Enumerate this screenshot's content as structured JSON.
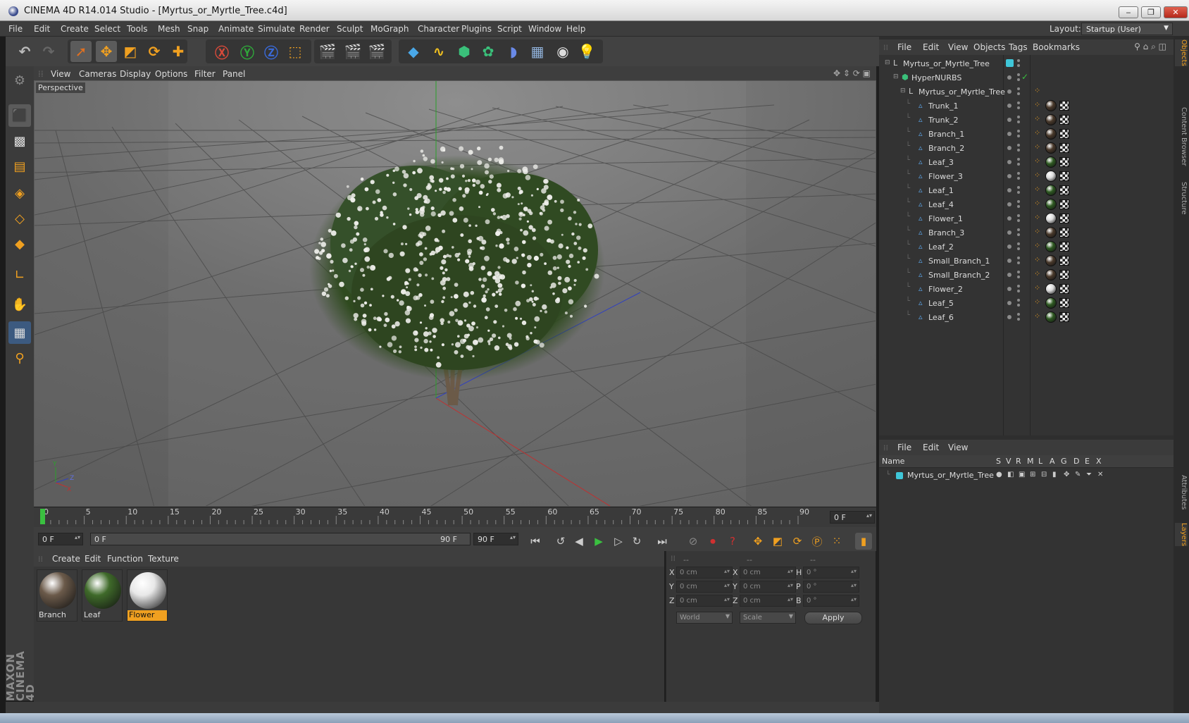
{
  "window": {
    "title": "CINEMA 4D R14.014 Studio - [Myrtus_or_Myrtle_Tree.c4d]",
    "min": "‒",
    "max": "❐",
    "close": "✕"
  },
  "menubar": [
    "File",
    "Edit",
    "Create",
    "Select",
    "Tools",
    "Mesh",
    "Snap",
    "Animate",
    "Simulate",
    "Render",
    "Sculpt",
    "MoGraph",
    "Character",
    "Plugins",
    "Script",
    "Window",
    "Help"
  ],
  "layout": {
    "label": "Layout:",
    "value": "Startup (User)"
  },
  "viewport": {
    "menu": [
      "View",
      "Cameras",
      "Display",
      "Options",
      "Filter",
      "Panel"
    ],
    "label": "Perspective",
    "axis": {
      "x": "X",
      "y": "Y",
      "z": "Z"
    }
  },
  "timeline": {
    "ticks": [
      "0",
      "5",
      "10",
      "15",
      "20",
      "25",
      "30",
      "35",
      "40",
      "45",
      "50",
      "55",
      "60",
      "65",
      "70",
      "75",
      "80",
      "85",
      "90"
    ],
    "current_frame": "0 F",
    "start_field": "0 F",
    "range_start": "0 F",
    "range_end": "90 F",
    "end_field": "90 F"
  },
  "materials": {
    "menu": [
      "Create",
      "Edit",
      "Function",
      "Texture"
    ],
    "items": [
      {
        "name": "Branch",
        "selected": false,
        "color": "#6b5a4a"
      },
      {
        "name": "Leaf",
        "selected": false,
        "color": "#3f6a2a"
      },
      {
        "name": "Flower",
        "selected": true,
        "color": "#e8e8e8"
      }
    ]
  },
  "coordinates": {
    "headers": [
      "--",
      "--",
      "--"
    ],
    "rows": [
      {
        "l1": "X",
        "v1": "0 cm",
        "l2": "X",
        "v2": "0 cm",
        "l3": "H",
        "v3": "0 °"
      },
      {
        "l1": "Y",
        "v1": "0 cm",
        "l2": "Y",
        "v2": "0 cm",
        "l3": "P",
        "v3": "0 °"
      },
      {
        "l1": "Z",
        "v1": "0 cm",
        "l2": "Z",
        "v2": "0 cm",
        "l3": "B",
        "v3": "0 °"
      }
    ],
    "mode1": "World",
    "mode2": "Scale",
    "apply": "Apply"
  },
  "objects_panel": {
    "menu": [
      "File",
      "Edit",
      "View",
      "Objects",
      "Tags",
      "Bookmarks"
    ],
    "tree": [
      {
        "name": "Myrtus_or_Myrtle_Tree",
        "level": 0,
        "type": "null"
      },
      {
        "name": "HyperNURBS",
        "level": 1,
        "type": "nurbs"
      },
      {
        "name": "Myrtus_or_Myrtle_Tree",
        "level": 2,
        "type": "null"
      },
      {
        "name": "Trunk_1",
        "level": 3,
        "type": "poly",
        "mat": "branch"
      },
      {
        "name": "Trunk_2",
        "level": 3,
        "type": "poly",
        "mat": "branch"
      },
      {
        "name": "Branch_1",
        "level": 3,
        "type": "poly",
        "mat": "branch"
      },
      {
        "name": "Branch_2",
        "level": 3,
        "type": "poly",
        "mat": "branch"
      },
      {
        "name": "Leaf_3",
        "level": 3,
        "type": "poly",
        "mat": "leaf"
      },
      {
        "name": "Flower_3",
        "level": 3,
        "type": "poly",
        "mat": "flower"
      },
      {
        "name": "Leaf_1",
        "level": 3,
        "type": "poly",
        "mat": "leaf"
      },
      {
        "name": "Leaf_4",
        "level": 3,
        "type": "poly",
        "mat": "leaf"
      },
      {
        "name": "Flower_1",
        "level": 3,
        "type": "poly",
        "mat": "flower"
      },
      {
        "name": "Branch_3",
        "level": 3,
        "type": "poly",
        "mat": "branch"
      },
      {
        "name": "Leaf_2",
        "level": 3,
        "type": "poly",
        "mat": "leaf"
      },
      {
        "name": "Small_Branch_1",
        "level": 3,
        "type": "poly",
        "mat": "branch"
      },
      {
        "name": "Small_Branch_2",
        "level": 3,
        "type": "poly",
        "mat": "branch"
      },
      {
        "name": "Flower_2",
        "level": 3,
        "type": "poly",
        "mat": "flower"
      },
      {
        "name": "Leaf_5",
        "level": 3,
        "type": "poly",
        "mat": "leaf"
      },
      {
        "name": "Leaf_6",
        "level": 3,
        "type": "poly",
        "mat": "leaf"
      }
    ]
  },
  "layers_panel": {
    "menu": [
      "File",
      "Edit",
      "View"
    ],
    "columns": [
      "Name",
      "S",
      "V",
      "R",
      "M",
      "L",
      "A",
      "G",
      "D",
      "E",
      "X"
    ],
    "rows": [
      {
        "name": "Myrtus_or_Myrtle_Tree",
        "color": "#3fc6d8"
      }
    ]
  },
  "right_tabs": [
    "Objects",
    "Content Browser",
    "Structure",
    "Attributes",
    "Layers"
  ],
  "logo": {
    "line1": "MAXON",
    "line2": "CINEMA 4D"
  },
  "colors": {
    "accent_orange": "#f0a020",
    "select_blue": "#3c7fd0",
    "layer_cyan": "#3fc6d8"
  }
}
